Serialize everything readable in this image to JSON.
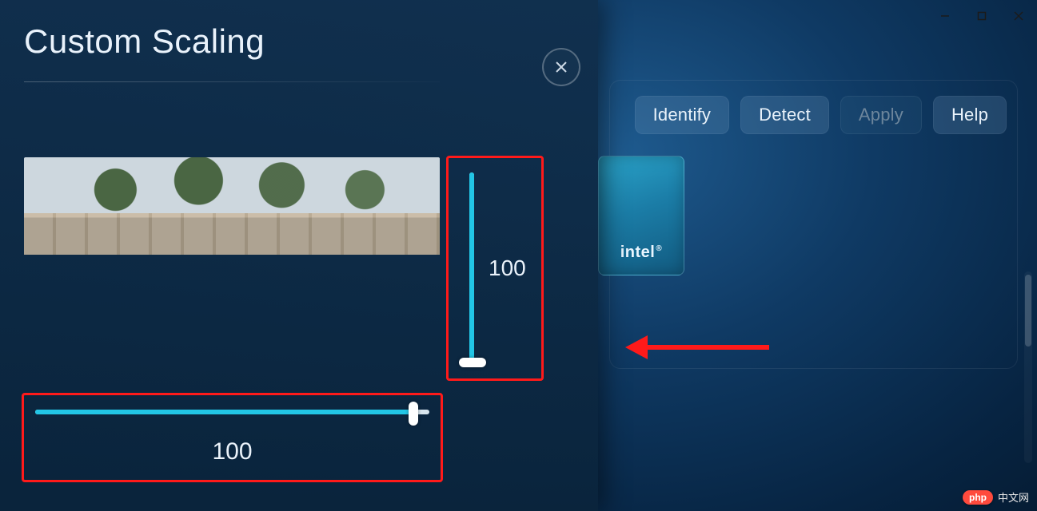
{
  "window": {
    "minimize_icon": "minimize",
    "maximize_icon": "maximize",
    "close_icon": "close"
  },
  "actions": {
    "identify": "Identify",
    "detect": "Detect",
    "apply": "Apply",
    "help": "Help"
  },
  "intel_tile": {
    "brand": "intel"
  },
  "modal": {
    "title": "Custom Scaling",
    "close_icon": "close",
    "horizontal_value": "100",
    "vertical_value": "100",
    "horizontal_percent": 96,
    "vertical_percent": 100
  },
  "watermark": {
    "badge": "php",
    "text": "中文网"
  }
}
